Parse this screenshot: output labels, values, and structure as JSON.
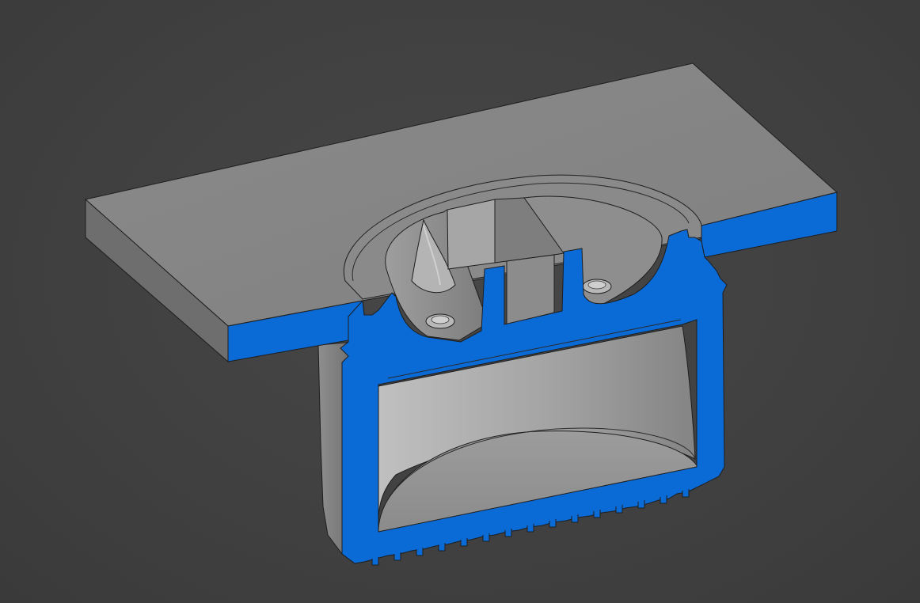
{
  "viewport": {
    "background_color": "#434343",
    "model": {
      "part_color": "#8c8c8c",
      "section_color": "#0a6ad6",
      "edge_color": "#1e1e1e",
      "view": "cross-section-isometric"
    }
  }
}
